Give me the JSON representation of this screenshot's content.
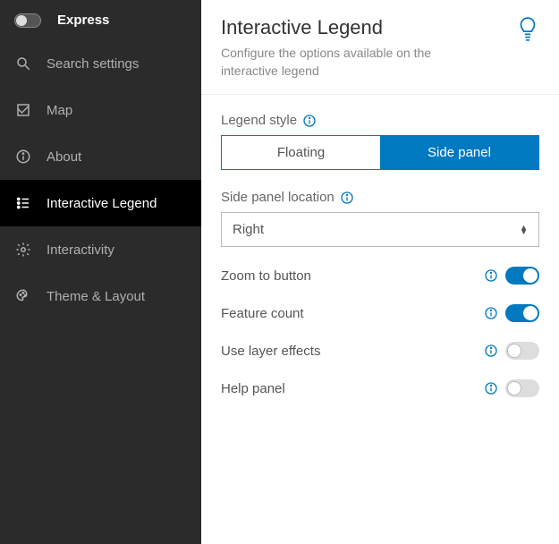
{
  "colors": {
    "accent": "#0079c1"
  },
  "sidebar": {
    "express_label": "Express",
    "items": [
      {
        "icon": "search",
        "label": "Search settings"
      },
      {
        "icon": "map",
        "label": "Map"
      },
      {
        "icon": "info",
        "label": "About"
      },
      {
        "icon": "legend",
        "label": "Interactive Legend",
        "active": true
      },
      {
        "icon": "gear",
        "label": "Interactivity"
      },
      {
        "icon": "palette",
        "label": "Theme & Layout"
      }
    ]
  },
  "header": {
    "title": "Interactive Legend",
    "subtitle": "Configure the options available on the interactive legend"
  },
  "legend_style": {
    "label": "Legend style",
    "options": [
      "Floating",
      "Side panel"
    ],
    "selected": "Side panel"
  },
  "side_panel_location": {
    "label": "Side panel location",
    "value": "Right"
  },
  "toggles": [
    {
      "label": "Zoom to button",
      "on": true
    },
    {
      "label": "Feature count",
      "on": true
    },
    {
      "label": "Use layer effects",
      "on": false
    },
    {
      "label": "Help panel",
      "on": false
    }
  ]
}
